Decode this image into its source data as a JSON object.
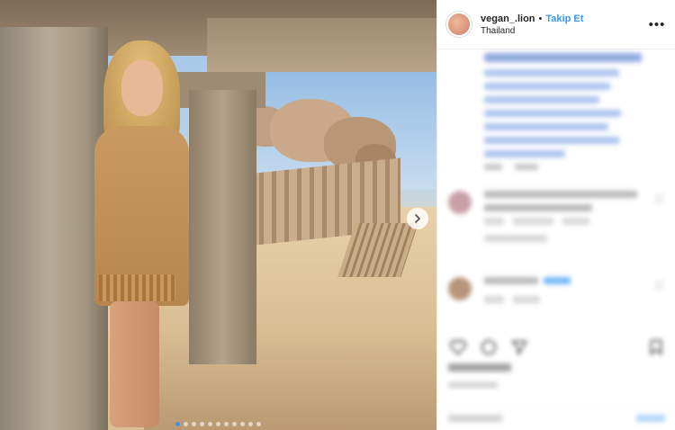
{
  "post": {
    "username": "vegan_.lion",
    "separator": "•",
    "follow_label": "Takip Et",
    "location": "Thailand",
    "more_label": "•••",
    "carousel": {
      "slide_count": 11,
      "active_index": 0
    }
  },
  "icons": {
    "more": "more-options-icon",
    "next": "chevron-right-icon",
    "like": "heart-icon",
    "comment": "comment-icon",
    "share": "share-icon",
    "save": "bookmark-icon"
  },
  "colors": {
    "accent": "#3897f0",
    "text": "#262626",
    "divider": "#efefef"
  }
}
